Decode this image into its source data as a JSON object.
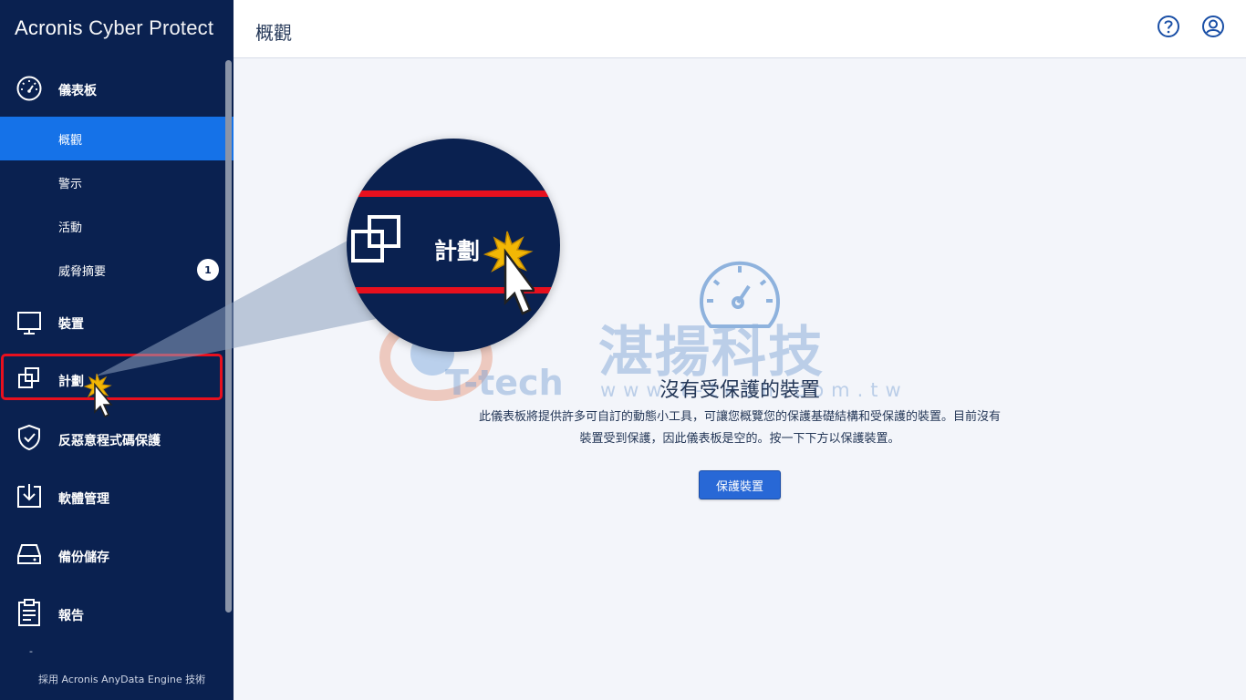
{
  "brand": {
    "name": "Acronis",
    "product": "Cyber Protect"
  },
  "sidebar": {
    "dashboard_label": "儀表板",
    "subitems": [
      {
        "label": "概觀",
        "active": true
      },
      {
        "label": "警示"
      },
      {
        "label": "活動"
      },
      {
        "label": "威脅摘要",
        "badge": "1"
      }
    ],
    "items": [
      {
        "label": "裝置",
        "icon": "monitor-icon"
      },
      {
        "label": "計劃",
        "icon": "plans-icon",
        "highlighted": true
      },
      {
        "label": "反惡意程式碼保護",
        "icon": "shield-icon"
      },
      {
        "label": "軟體管理",
        "icon": "software-download-icon"
      },
      {
        "label": "備份儲存",
        "icon": "storage-drive-icon"
      },
      {
        "label": "報告",
        "icon": "report-clipboard-icon"
      }
    ],
    "footer_dash": "-",
    "footer": "採用 Acronis AnyData Engine 技術"
  },
  "header": {
    "title": "概觀",
    "help_icon": "help-icon",
    "account_icon": "account-icon"
  },
  "main": {
    "empty_title": "沒有受保護的裝置",
    "empty_desc_line1": "此儀表板將提供許多可自訂的動態小工具，可讓您概覽您的保護基礎結構和受保護的裝置。目前沒有",
    "empty_desc_line2": "裝置受到保護，因此儀表板是空的。按一下下方以保護裝置。",
    "protect_button": "保護裝置"
  },
  "watermark": {
    "brand": "T-tech",
    "chinese": "湛揚科技",
    "url": "www.t-tech.com.tw"
  },
  "magnifier": {
    "label": "計劃"
  },
  "colors": {
    "sidebar_bg": "#0a2150",
    "active_item": "#1572e8",
    "highlight": "#e8101e",
    "primary_button": "#2868d6",
    "page_bg": "#f3f5fa"
  }
}
